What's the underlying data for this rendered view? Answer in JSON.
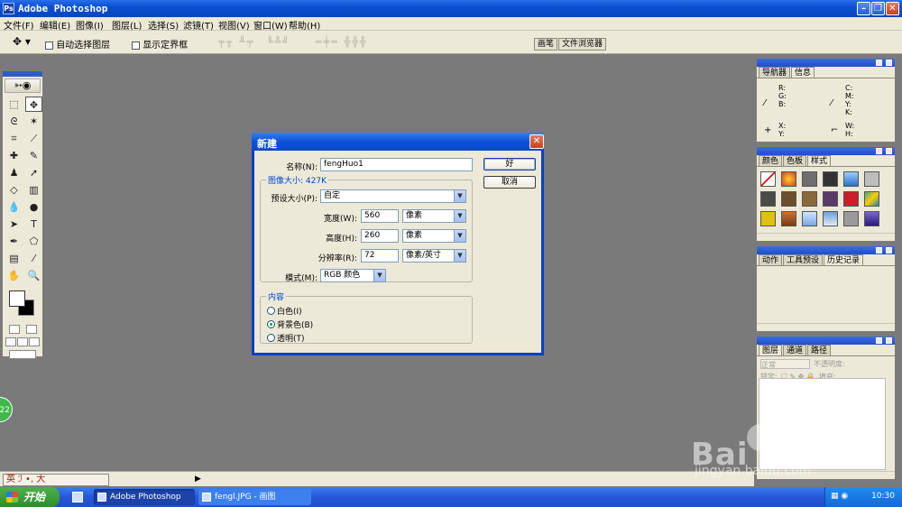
{
  "window": {
    "title": "Adobe Photoshop",
    "app_icon": "Ps"
  },
  "menu": [
    "文件(F)",
    "编辑(E)",
    "图像(I)",
    "图层(L)",
    "选择(S)",
    "滤镜(T)",
    "视图(V)",
    "窗口(W)",
    "帮助(H)"
  ],
  "options_bar": {
    "auto_select": "自动选择图层",
    "show_bounds": "显示定界框",
    "palette_tabs": [
      "画笔",
      "文件浏览器"
    ]
  },
  "panels": {
    "navigator": {
      "tabs": [
        "导航器",
        "信息"
      ]
    },
    "info": {
      "rgb": [
        "R:",
        "G:",
        "B:"
      ],
      "cmyk": [
        "C:",
        "M:",
        "Y:",
        "K:"
      ],
      "xy": [
        "X:",
        "Y:"
      ],
      "wh": [
        "W:",
        "H:"
      ]
    },
    "color": {
      "tabs": [
        "颜色",
        "色板",
        "样式"
      ]
    },
    "history": {
      "tabs": [
        "动作",
        "工具预设",
        "历史记录"
      ]
    },
    "layers": {
      "tabs": [
        "图层",
        "通道",
        "路径"
      ],
      "mode": "正常",
      "opacity_label": "不透明度:",
      "lock_label": "锁定:",
      "fill_label": "填充:"
    }
  },
  "dialog": {
    "title": "新建",
    "name_label": "名称(N):",
    "name_value": "fengHuo1",
    "ok": "好",
    "cancel": "取消",
    "image_size_label": "图像大小: 427K",
    "preset_label": "预设大小(P):",
    "preset_value": "自定",
    "width_label": "宽度(W):",
    "width_value": "560",
    "width_unit": "像素",
    "height_label": "高度(H):",
    "height_value": "260",
    "height_unit": "像素",
    "resolution_label": "分辨率(R):",
    "resolution_value": "72",
    "resolution_unit": "像素/英寸",
    "mode_label": "模式(M):",
    "mode_value": "RGB 颜色",
    "contents_label": "内容",
    "contents": [
      "白色(I)",
      "背景色(B)",
      "透明(T)"
    ]
  },
  "ime_bar": "英 ℐ •, 大",
  "taskbar": {
    "start": "开始",
    "tasks": [
      "Adobe Photoshop",
      "fengl.JPG - 画图"
    ],
    "clock": "10:30"
  },
  "watermark": {
    "brand": "Bai 经验",
    "url": "jingyan.baidu.com"
  },
  "bubble": "22"
}
